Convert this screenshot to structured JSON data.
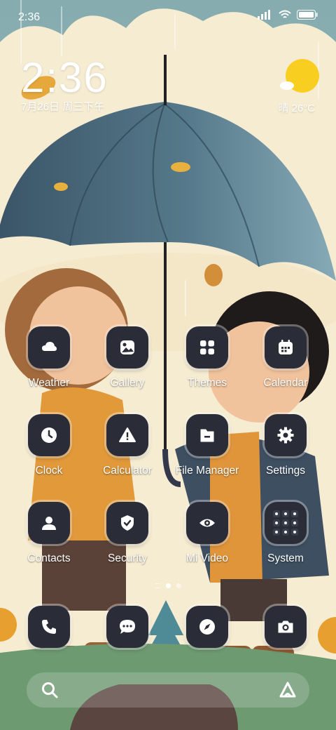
{
  "status": {
    "time": "2:36"
  },
  "clock_widget": {
    "time": "2:36",
    "date": "7月26日 周三下午"
  },
  "weather_widget": {
    "text": "晴 26°C"
  },
  "grid": [
    {
      "label": "Weather",
      "icon": "weather-icon"
    },
    {
      "label": "Gallery",
      "icon": "gallery-icon"
    },
    {
      "label": "Themes",
      "icon": "themes-icon"
    },
    {
      "label": "Calendar",
      "icon": "calendar-icon"
    },
    {
      "label": "Clock",
      "icon": "clock-icon"
    },
    {
      "label": "Calculator",
      "icon": "calculator-icon"
    },
    {
      "label": "File Manager",
      "icon": "file-manager-icon"
    },
    {
      "label": "Settings",
      "icon": "settings-icon"
    },
    {
      "label": "Contacts",
      "icon": "contacts-icon"
    },
    {
      "label": "Security",
      "icon": "security-icon"
    },
    {
      "label": "Mi Video",
      "icon": "mi-video-icon"
    },
    {
      "label": "System",
      "icon": "system-folder-icon"
    }
  ],
  "dock": [
    {
      "icon": "phone-icon"
    },
    {
      "icon": "messages-icon"
    },
    {
      "icon": "browser-icon"
    },
    {
      "icon": "camera-icon"
    }
  ],
  "colors": {
    "tile": "#2a2c38",
    "sky": "#7fa7ad",
    "cream": "#f6ecd2",
    "umbrella": "#3e5a6e"
  }
}
